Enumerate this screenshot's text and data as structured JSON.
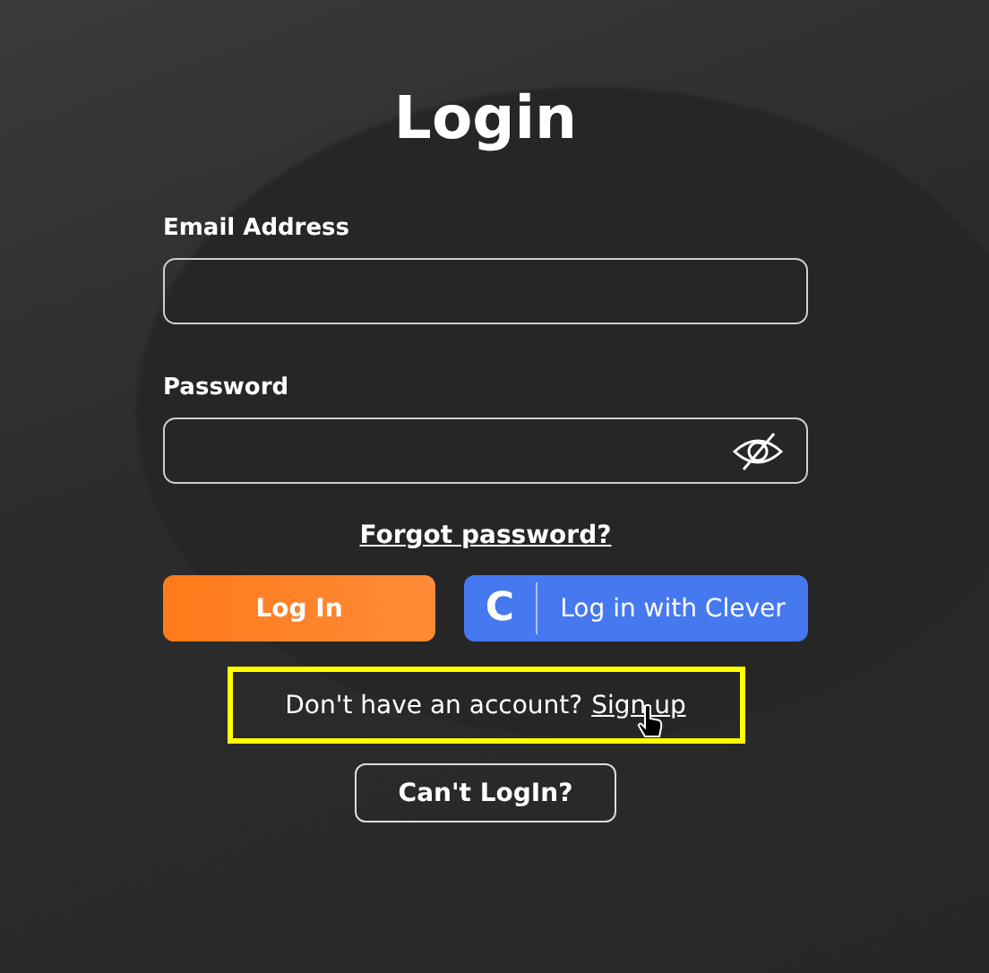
{
  "title": "Login",
  "fields": [
    {
      "label": "Email Address",
      "kind": "text"
    },
    {
      "label": "Password",
      "kind": "password"
    }
  ],
  "forgot_link": "Forgot password?",
  "login_button": "Log In",
  "clever_button": {
    "logo": "C",
    "label": "Log in with Clever"
  },
  "signup": {
    "text": "Don't have an account?",
    "link": "Sign up",
    "highlighted": true
  },
  "cant_login_button": "Can't LogIn?"
}
